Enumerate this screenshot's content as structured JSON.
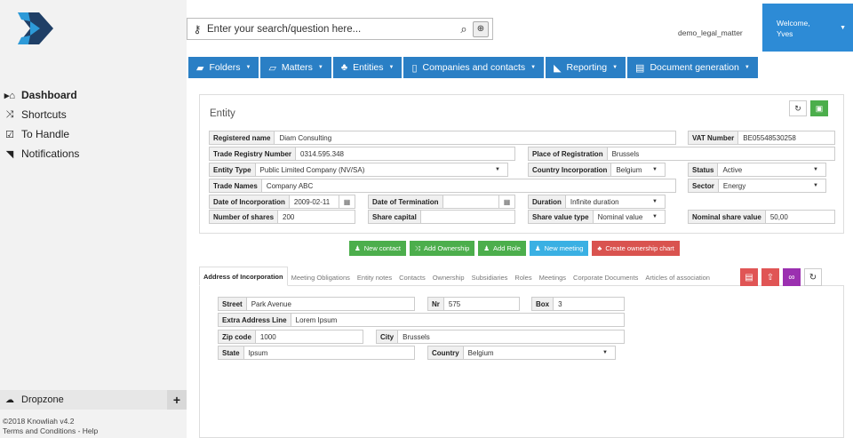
{
  "app": {
    "footer_line1": "©2018 Knowliah v4.2",
    "footer_line2": "Terms and Conditions - Help"
  },
  "sidebar": {
    "items": [
      {
        "label": "Dashboard",
        "icon": "home-icon"
      },
      {
        "label": "Shortcuts",
        "icon": "shuffle-icon"
      },
      {
        "label": "To Handle",
        "icon": "checkbox-icon"
      },
      {
        "label": "Notifications",
        "icon": "rss-icon"
      }
    ],
    "dropzone_label": "Dropzone"
  },
  "search": {
    "placeholder": "Enter your search/question here..."
  },
  "header": {
    "matter": "demo_legal_matter",
    "welcome": "Welcome,",
    "user": "Yves"
  },
  "menu": [
    {
      "label": "Folders",
      "icon": "folder-icon"
    },
    {
      "label": "Matters",
      "icon": "book-icon"
    },
    {
      "label": "Entities",
      "icon": "sitemap-icon"
    },
    {
      "label": "Companies and contacts",
      "icon": "building-icon"
    },
    {
      "label": "Reporting",
      "icon": "area-chart-icon"
    },
    {
      "label": "Document generation",
      "icon": "file-icon"
    }
  ],
  "entity": {
    "title": "Entity",
    "registered_name": {
      "label": "Registered name",
      "value": "Diam Consulting"
    },
    "vat": {
      "label": "VAT Number",
      "value": "BE05548530258"
    },
    "trade_registry": {
      "label": "Trade Registry Number",
      "value": "0314.595.348"
    },
    "place_registration": {
      "label": "Place of Registration",
      "value": "Brussels"
    },
    "entity_type": {
      "label": "Entity Type",
      "value": "Public Limited Company (NV/SA)"
    },
    "country_incorporation": {
      "label": "Country Incorporation",
      "value": "Belgium"
    },
    "status": {
      "label": "Status",
      "value": "Active"
    },
    "trade_names": {
      "label": "Trade Names",
      "value": "Company ABC"
    },
    "sector": {
      "label": "Sector",
      "value": "Energy"
    },
    "date_incorporation": {
      "label": "Date of Incorporation",
      "value": "2009-02-11"
    },
    "date_termination": {
      "label": "Date of Termination",
      "value": ""
    },
    "duration": {
      "label": "Duration",
      "value": "Infinite duration"
    },
    "number_shares": {
      "label": "Number of shares",
      "value": "200"
    },
    "share_capital": {
      "label": "Share capital",
      "value": ""
    },
    "share_value_type": {
      "label": "Share value type",
      "value": "Nominal value"
    },
    "nominal_share_value": {
      "label": "Nominal share value",
      "value": "50,00"
    }
  },
  "actions": [
    {
      "label": "New contact",
      "color": "#4cae4c",
      "icon": "user-icon"
    },
    {
      "label": "Add Ownership",
      "color": "#4cae4c",
      "icon": "shuffle-icon"
    },
    {
      "label": "Add Role",
      "color": "#4cae4c",
      "icon": "user-icon"
    },
    {
      "label": "New meeting",
      "color": "#3ab0e3",
      "icon": "users-icon"
    },
    {
      "label": "Create ownership chart",
      "color": "#d9534f",
      "icon": "sitemap-icon"
    }
  ],
  "tabs": [
    "Address of Incorporation",
    "Meeting Obligations",
    "Entity notes",
    "Contacts",
    "Ownership",
    "Subsidiaries",
    "Roles",
    "Meetings",
    "Corporate Documents",
    "Articles of association"
  ],
  "address": {
    "street": {
      "label": "Street",
      "value": "Park Avenue"
    },
    "nr": {
      "label": "Nr",
      "value": "575"
    },
    "box": {
      "label": "Box",
      "value": "3"
    },
    "extra": {
      "label": "Extra Address Line",
      "value": "Lorem Ipsum"
    },
    "zip": {
      "label": "Zip code",
      "value": "1000"
    },
    "city": {
      "label": "City",
      "value": "Brussels"
    },
    "state": {
      "label": "State",
      "value": "Ipsum"
    },
    "country": {
      "label": "Country",
      "value": "Belgium"
    }
  }
}
